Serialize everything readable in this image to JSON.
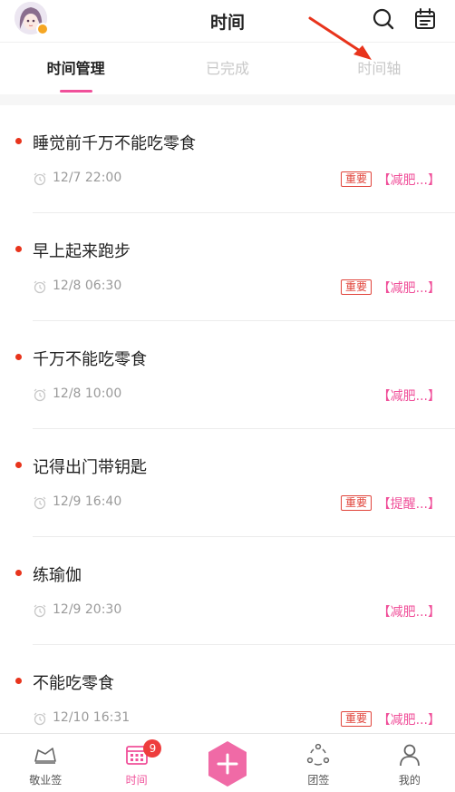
{
  "header": {
    "title": "时间"
  },
  "tabs": [
    {
      "label": "时间管理",
      "active": true
    },
    {
      "label": "已完成",
      "active": false
    },
    {
      "label": "时间轴",
      "active": false
    }
  ],
  "items": [
    {
      "name": "睡觉前千万不能吃零食",
      "time": "12/7 22:00",
      "important": "重要",
      "category": "【减肥...】"
    },
    {
      "name": "早上起来跑步",
      "time": "12/8 06:30",
      "important": "重要",
      "category": "【减肥...】"
    },
    {
      "name": "千万不能吃零食",
      "time": "12/8 10:00",
      "important": "",
      "category": "【减肥...】"
    },
    {
      "name": "记得出门带钥匙",
      "time": "12/9 16:40",
      "important": "重要",
      "category": "【提醒...】"
    },
    {
      "name": "练瑜伽",
      "time": "12/9 20:30",
      "important": "",
      "category": "【减肥...】"
    },
    {
      "name": "不能吃零食",
      "time": "12/10 16:31",
      "important": "重要",
      "category": "【减肥...】"
    }
  ],
  "bottom_nav": [
    {
      "label": "敬业签",
      "icon": "sign-icon"
    },
    {
      "label": "时间",
      "icon": "calendar-grid-icon",
      "badge": "9"
    },
    {
      "label": "",
      "icon": "add-icon"
    },
    {
      "label": "团签",
      "icon": "team-icon"
    },
    {
      "label": "我的",
      "icon": "person-icon"
    }
  ],
  "colors": {
    "accent": "#f0509a",
    "important": "#e0433a",
    "dot": "#e8341c"
  }
}
